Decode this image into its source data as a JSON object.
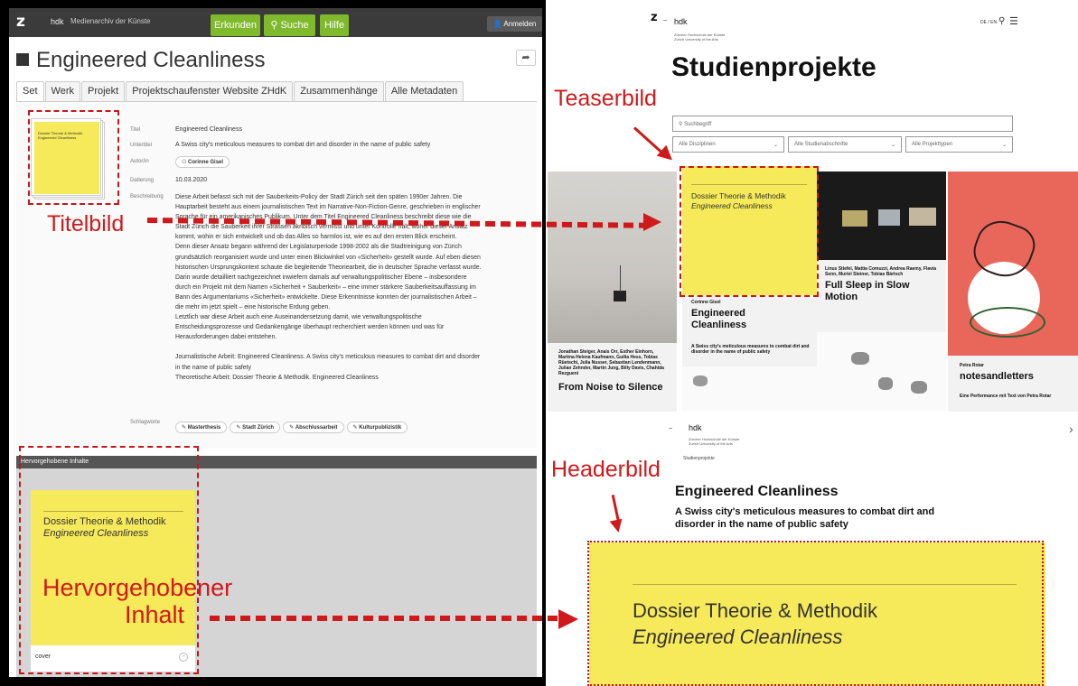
{
  "left": {
    "topbar": {
      "logo": "z",
      "hdk": "hdk",
      "subtitle": "Medienarchiv der Künste",
      "erkunden": "Erkunden",
      "suche": "Suche",
      "hilfe": "Hilfe",
      "anmelden": "Anmelden"
    },
    "page_title": "Engineered Cleanliness",
    "tabs": [
      "Set",
      "Werk",
      "Projekt",
      "Projektschaufenster Website ZHdK",
      "Zusammenhänge",
      "Alle Metadaten"
    ],
    "thumb": {
      "line1": "Dossier Theorie & Methodik",
      "line2": "Engineered Cleanliness"
    },
    "meta": {
      "titel_label": "Titel",
      "titel": "Engineered Cleanliness",
      "untertitel_label": "Untertitel",
      "untertitel": "A Swiss city's meticulous measures to combat dirt and disorder in the name of public safety",
      "autorin_label": "Autor/in",
      "autorin": "Corinne Gisel",
      "datierung_label": "Datierung",
      "datierung": "10.03.2020",
      "beschreibung_label": "Beschreibung"
    },
    "description": [
      "Diese Arbeit befasst sich mit der Sauberkeits-Policy der Stadt Zürich seit den späten 1990er Jahren. Die",
      "Hauptarbeit besteht aus einem journalistischen Text im Narrative-Non-Fiction-Genre, geschrieben in englischer",
      "Sprache für ein amerikanisches Publikum. Unter dem Titel Engineered Cleanliness beschreibt diese wie die",
      "Stadt Zürich die Sauberkeit ihrer Strassen akribisch vermisst und unter Kontrolle hält, woher dieser Ansatz",
      "kommt, wohin er sich entwickelt und ob das Alles so harmlos ist, wie es auf den ersten Blick erscheint.",
      "Denn dieser Ansatz begann während der Legislaturperiode 1998-2002 als die Stadtreinigung von Zürich",
      "grundsätzlich reorganisiert wurde und unter einen Blickwinkel von «Sicherheit» gestellt wurde. Auf eben diesen",
      "historischen Ursprungskontext schaute die begleitende Theoriearbeit, die in deutscher Sprache verfasst wurde.",
      "Darin wurde detailliert nachgezeichnet inwiefern damals auf verwaltungspolitischer Ebene – insbesondere",
      "durch ein Projekt mit dem Namen «Sicherheit + Sauberkeit» – eine immer stärkere Sauberkeitsauffassung im",
      "Bann des Argumentariums «Sicherheit» entwickelte. Diese Erkenntnisse konnten der journalistischen Arbeit –",
      "die mehr im jetzt spielt – eine historische Erdung geben.",
      "Letztlich war diese Arbeit auch eine Auseinandersetzung damit, wie verwaltungspolitische",
      "Entscheidungsprozesse und Gedankengänge überhaupt recherchiert werden können und was für",
      "Herausforderungen dabei entstehen.",
      "",
      "Journalistische Arbeit: Engineered Cleanliness. A Swiss city's meticulous measures to combat dirt and disorder",
      "in the name of public safety",
      "Theoretische Arbeit: Dossier Theorie & Methodik. Engineered Cleanliness"
    ],
    "schlagworte_label": "Schlagworte",
    "schlagworte": [
      "Masterthesis",
      "Stadt Zürich",
      "Abschlussarbeit",
      "Kulturpublizistik"
    ],
    "highlight_bar": "Hervorgehobene Inhalte",
    "cover": {
      "line1": "Dossier Theorie & Methodik",
      "line2": "Engineered Cleanliness",
      "caption": "cover"
    }
  },
  "annotations": {
    "titelbild": "Titelbild",
    "teaserbild": "Teaserbild",
    "headerbild": "Headerbild",
    "hervor1": "Hervorgehobener",
    "hervor2": "Inhalt"
  },
  "right_top": {
    "logo": "z",
    "hdk": "hdk",
    "school_de": "Zürcher Hochschule der Künste",
    "school_en": "Zurich University of the Arts",
    "lang": "DE / EN",
    "heading": "Studienprojekte",
    "search_placeholder": "Suchbegriff",
    "filters": [
      "Alle Disziplinen",
      "Alle Studienabschnitte",
      "Alle Projekttypen"
    ],
    "tiles": {
      "t1_authors": "Jonathan Steiger, Anais Orr, Esther Einhorn, Martina Helena Kaufmann, Guilia Hess, Tobias Rüetschi, Julia Nusser, Sebastian Lendenmann, Julian Zehnder, Martin Jung, Billy Davis, Chahida Rezgueni",
      "t1_title": "From Noise to Silence",
      "t2_line1": "Dossier Theorie & Methodik",
      "t2_line2": "Engineered Cleanliness",
      "t2_author": "Corinne Gisel",
      "t2_title": "Engineered Cleanliness",
      "t2_sub": "A Swiss city's meticulous measures to combat dirt and disorder in the name of public safety",
      "t3_authors": "Linus Stiefel, Mattia Comuzzi, Andrea Raemy, Flavia Senn, Muriel Steiner, Tobias Bärtsch",
      "t3_title": "Full Sleep in Slow Motion",
      "t4_author": "Petra Rotar",
      "t4_title": "notesandletters",
      "t4_sub": "Eine Performance mit Text von Petra Rotar"
    }
  },
  "right_bottom": {
    "logo": "z",
    "hdk": "hdk",
    "school_de": "Zürcher Hochschule der Künste",
    "school_en": "Zurich University of the Arts",
    "breadcrumb": "Studienprojekte",
    "title": "Engineered Cleanliness",
    "subtitle_line1": "A Swiss city's meticulous measures to combat dirt and",
    "subtitle_line2": "disorder in the name of public safety",
    "header_line1": "Dossier Theorie & Methodik",
    "header_line2": "Engineered Cleanliness"
  },
  "colors": {
    "green": "#7fb92c",
    "yellow": "#f6e95a",
    "annotation_red": "#d0191a",
    "coral": "#e8675a"
  }
}
